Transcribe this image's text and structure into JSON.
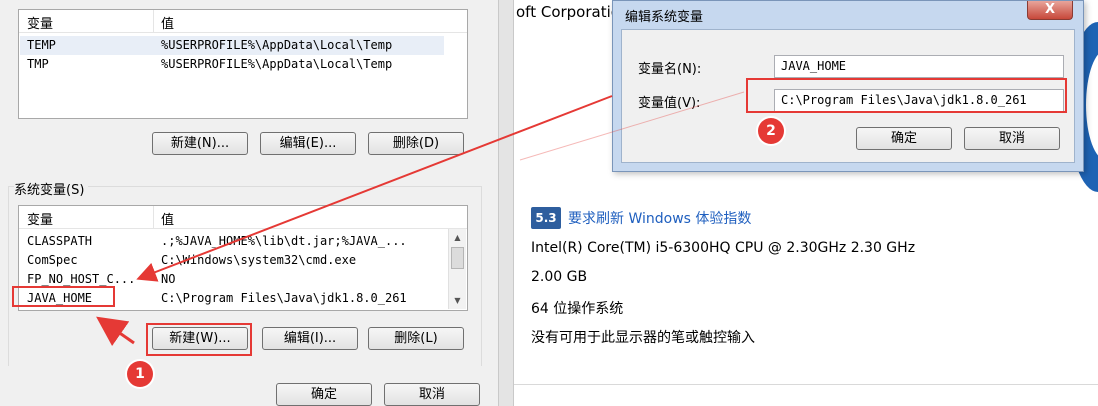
{
  "user_vars": {
    "col_name": "变量",
    "col_value": "值",
    "rows": [
      {
        "name": "TEMP",
        "value": "%USERPROFILE%\\AppData\\Local\\Temp"
      },
      {
        "name": "TMP",
        "value": "%USERPROFILE%\\AppData\\Local\\Temp"
      }
    ],
    "new_button": "新建(N)...",
    "edit_button": "编辑(E)...",
    "delete_button": "删除(D)"
  },
  "system_vars": {
    "group_label": "系统变量(S)",
    "col_name": "变量",
    "col_value": "值",
    "rows": [
      {
        "name": "CLASSPATH",
        "value": ".;%JAVA_HOME%\\lib\\dt.jar;%JAVA_..."
      },
      {
        "name": "ComSpec",
        "value": "C:\\Windows\\system32\\cmd.exe"
      },
      {
        "name": "FP_NO_HOST_C...",
        "value": "NO"
      },
      {
        "name": "JAVA_HOME",
        "value": "C:\\Program Files\\Java\\jdk1.8.0_261"
      }
    ],
    "new_button": "新建(W)...",
    "edit_button": "编辑(I)...",
    "delete_button": "删除(L)"
  },
  "footer": {
    "ok_button": "确定",
    "cancel_button": "取消"
  },
  "system_info": {
    "company_fragment": "oft Corporatio",
    "score": "5.3",
    "score_link": "要求刷新 Windows 体验指数",
    "cpu": "Intel(R) Core(TM) i5-6300HQ CPU @ 2.30GHz   2.30 GHz",
    "ram": "2.00 GB",
    "os_type": "64 位操作系统",
    "pen_touch": "没有可用于此显示器的笔或触控输入"
  },
  "edit_dialog": {
    "title": "编辑系统变量",
    "close_label": "X",
    "name_label": "变量名(N):",
    "name_value": "JAVA_HOME",
    "value_label": "变量值(V):",
    "value_value": "C:\\Program Files\\Java\\jdk1.8.0_261",
    "ok_button": "确定",
    "cancel_button": "取消"
  },
  "annotations": {
    "step1": "1",
    "step2": "2",
    "color": "#e53935"
  }
}
